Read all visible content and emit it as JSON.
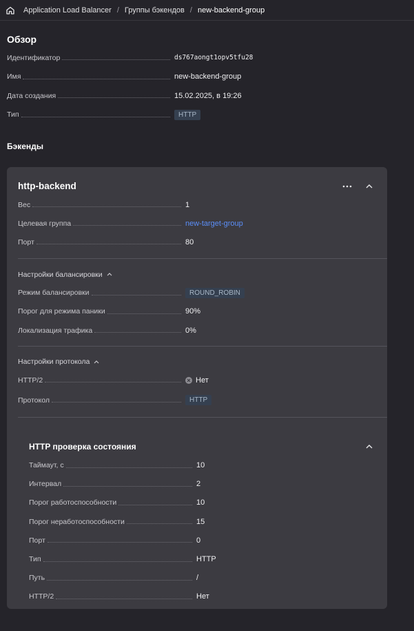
{
  "breadcrumbs": [
    "Application Load Balancer",
    "Группы бэкендов",
    "new-backend-group"
  ],
  "overview": {
    "title": "Обзор",
    "fields": [
      {
        "label": "Идентификатор",
        "value": "ds767aongt1opv5tfu28"
      },
      {
        "label": "Имя",
        "value": "new-backend-group"
      },
      {
        "label": "Дата создания",
        "value": "15.02.2025, в 19:26"
      },
      {
        "label": "Тип",
        "value": "HTTP"
      }
    ]
  },
  "backends": {
    "title": "Бэкенды",
    "backend": {
      "name": "http-backend",
      "weight_label": "Вес",
      "weight": "1",
      "target_group_label": "Целевая группа",
      "target_group": "new-target-group",
      "port_label": "Порт",
      "port": "80",
      "balancing": {
        "title": "Настройки балансировки",
        "mode_label": "Режим балансировки",
        "mode": "ROUND_ROBIN",
        "panic_label": "Порог для режима паники",
        "panic": "90%",
        "locality_label": "Локализация трафика",
        "locality": "0%"
      },
      "protocol": {
        "title": "Настройки протокола",
        "http2_label": "HTTP/2",
        "http2": "Нет",
        "protocol_label": "Протокол",
        "protocol": "HTTP"
      },
      "healthcheck": {
        "title": "HTTP проверка состояния",
        "fields": [
          {
            "label": "Таймаут, с",
            "value": "10"
          },
          {
            "label": "Интервал",
            "value": "2"
          },
          {
            "label": "Порог работоспособности",
            "value": "10"
          },
          {
            "label": "Порог неработоспособности",
            "value": "15"
          },
          {
            "label": "Порт",
            "value": "0"
          },
          {
            "label": "Тип",
            "value": "HTTP"
          },
          {
            "label": "Путь",
            "value": "/"
          },
          {
            "label": "HTTP/2",
            "value": "Нет"
          }
        ]
      }
    }
  },
  "colors": {
    "background": "#25242a",
    "card": "#3c3b41",
    "link": "#5b8ef7",
    "tag": "#354050"
  }
}
